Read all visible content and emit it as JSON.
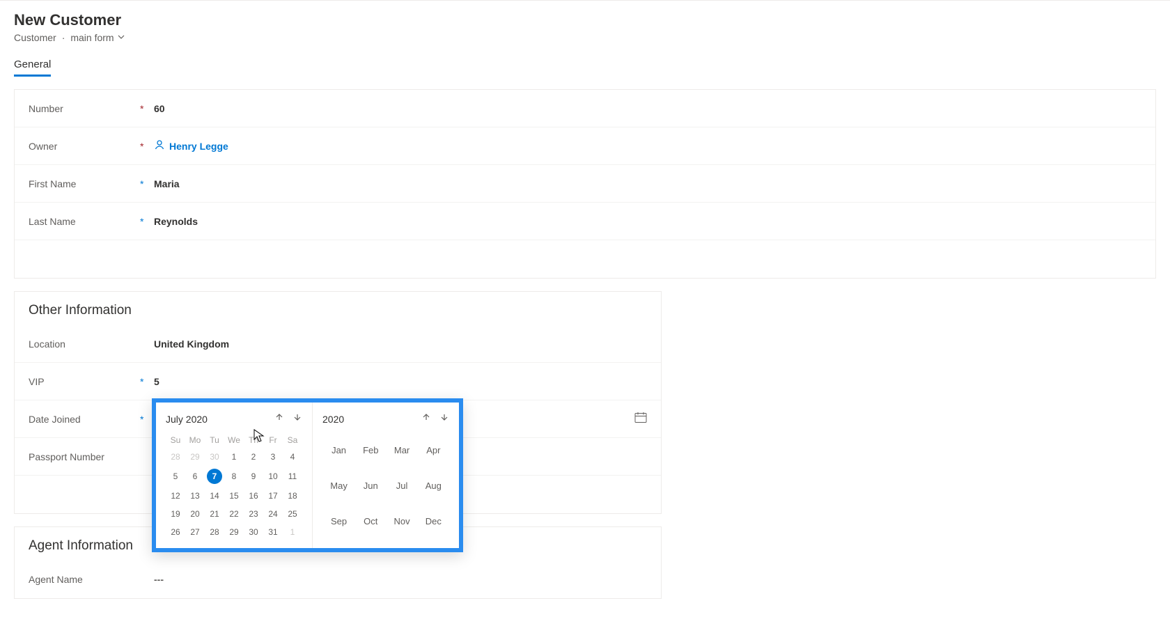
{
  "header": {
    "title": "New Customer",
    "entity": "Customer",
    "form": "main form"
  },
  "tabs": {
    "general": "General"
  },
  "fields": {
    "number_label": "Number",
    "number_value": "60",
    "owner_label": "Owner",
    "owner_value": "Henry Legge",
    "first_name_label": "First Name",
    "first_name_value": "Maria",
    "last_name_label": "Last Name",
    "last_name_value": "Reynolds"
  },
  "other": {
    "section_title": "Other Information",
    "location_label": "Location",
    "location_value": "United Kingdom",
    "vip_label": "VIP",
    "vip_value": "5",
    "date_joined_label": "Date Joined",
    "date_joined_value": "---",
    "passport_label": "Passport Number",
    "passport_value": "---"
  },
  "agent": {
    "section_title": "Agent Information",
    "name_label": "Agent Name",
    "name_value": "---"
  },
  "calendar": {
    "month_title": "July 2020",
    "year_title": "2020",
    "weekdays": [
      "Su",
      "Mo",
      "Tu",
      "We",
      "Th",
      "Fr",
      "Sa"
    ],
    "weeks": [
      [
        {
          "d": "28",
          "o": true
        },
        {
          "d": "29",
          "o": true
        },
        {
          "d": "30",
          "o": true
        },
        {
          "d": "1"
        },
        {
          "d": "2"
        },
        {
          "d": "3"
        },
        {
          "d": "4"
        }
      ],
      [
        {
          "d": "5"
        },
        {
          "d": "6"
        },
        {
          "d": "7",
          "sel": true
        },
        {
          "d": "8"
        },
        {
          "d": "9"
        },
        {
          "d": "10"
        },
        {
          "d": "11"
        }
      ],
      [
        {
          "d": "12"
        },
        {
          "d": "13"
        },
        {
          "d": "14"
        },
        {
          "d": "15"
        },
        {
          "d": "16"
        },
        {
          "d": "17"
        },
        {
          "d": "18"
        }
      ],
      [
        {
          "d": "19"
        },
        {
          "d": "20"
        },
        {
          "d": "21"
        },
        {
          "d": "22"
        },
        {
          "d": "23"
        },
        {
          "d": "24"
        },
        {
          "d": "25"
        }
      ],
      [
        {
          "d": "26"
        },
        {
          "d": "27"
        },
        {
          "d": "28"
        },
        {
          "d": "29"
        },
        {
          "d": "30"
        },
        {
          "d": "31"
        },
        {
          "d": "1",
          "o": true
        }
      ]
    ],
    "months": [
      [
        "Jan",
        "Feb",
        "Mar",
        "Apr"
      ],
      [
        "May",
        "Jun",
        "Jul",
        "Aug"
      ],
      [
        "Sep",
        "Oct",
        "Nov",
        "Dec"
      ]
    ]
  }
}
